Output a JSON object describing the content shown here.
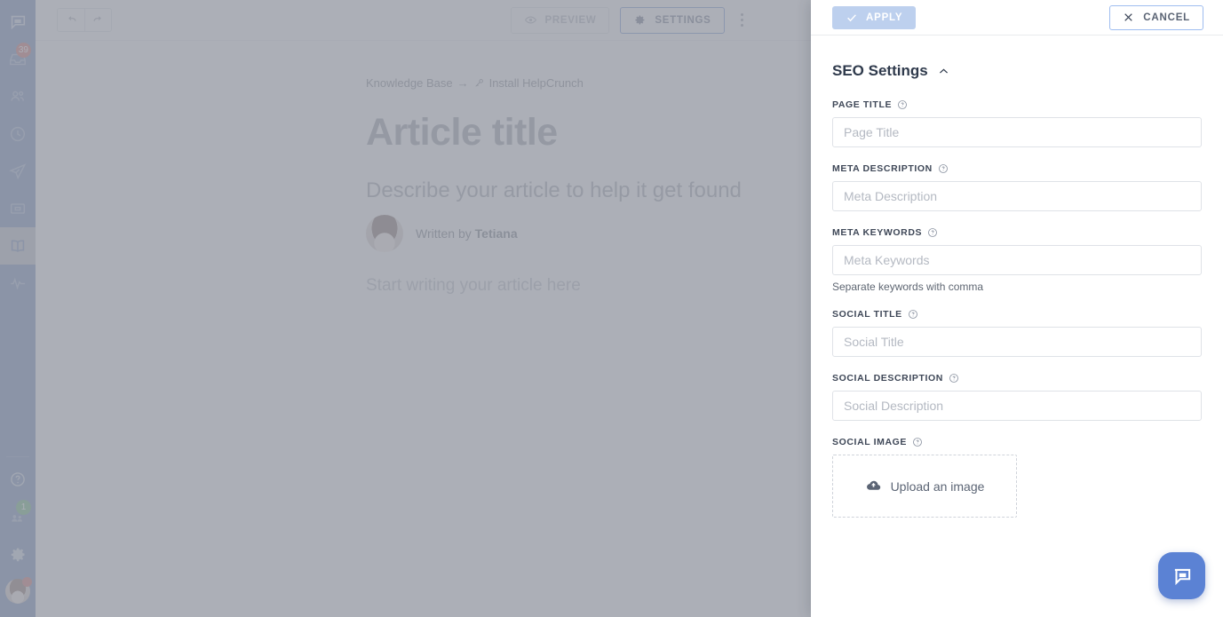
{
  "sidebar": {
    "items": [
      {
        "name": "chat-icon",
        "badge": null
      },
      {
        "name": "inbox-icon",
        "badge": "39",
        "badge_color": "red"
      },
      {
        "name": "contacts-icon",
        "badge": null
      },
      {
        "name": "history-clock-icon",
        "badge": null
      },
      {
        "name": "send-paper-plane-icon",
        "badge": null
      },
      {
        "name": "archive-box-icon",
        "badge": null
      },
      {
        "name": "knowledge-base-book-icon",
        "badge": null,
        "active": true
      },
      {
        "name": "analytics-pulse-icon",
        "badge": null
      }
    ],
    "bottom_items": [
      {
        "name": "help-question-icon",
        "badge": null
      },
      {
        "name": "team-members-icon",
        "badge": "1",
        "badge_color": "green"
      },
      {
        "name": "settings-gear-icon",
        "badge": null
      }
    ],
    "colors": {
      "background": "#4a6aa6",
      "badge_red": "#c0453f",
      "badge_green": "#3f9e55"
    }
  },
  "toolbar": {
    "undo_label": "Undo",
    "redo_label": "Redo",
    "preview_label": "PREVIEW",
    "settings_label": "SETTINGS",
    "more_label": "More options"
  },
  "article": {
    "breadcrumb_root": "Knowledge Base",
    "breadcrumb_arrow": "→",
    "breadcrumb_current": "Install HelpCrunch",
    "title_placeholder": "Article title",
    "subtitle_placeholder": "Describe your article to help it get found",
    "written_by_label": "Written by",
    "author": "Tetiana",
    "body_placeholder": "Start writing your article here"
  },
  "panel": {
    "apply_label": "APPLY",
    "cancel_label": "CANCEL",
    "section_title": "SEO Settings",
    "fields": [
      {
        "label": "PAGE TITLE",
        "placeholder": "Page Title",
        "value": "",
        "hint": ""
      },
      {
        "label": "META DESCRIPTION",
        "placeholder": "Meta Description",
        "value": "",
        "hint": ""
      },
      {
        "label": "META KEYWORDS",
        "placeholder": "Meta Keywords",
        "value": "",
        "hint": "Separate keywords with comma"
      },
      {
        "label": "SOCIAL TITLE",
        "placeholder": "Social Title",
        "value": "",
        "hint": ""
      },
      {
        "label": "SOCIAL DESCRIPTION",
        "placeholder": "Social Description",
        "value": "",
        "hint": ""
      }
    ],
    "social_image_label": "SOCIAL IMAGE",
    "upload_label": "Upload an image",
    "colors": {
      "apply_bg": "#bdd0ee",
      "cancel_border": "#9fbdf0",
      "accent": "#5078c8"
    }
  },
  "chat_widget": {
    "label": "Open chat",
    "color": "#5b82d4"
  }
}
